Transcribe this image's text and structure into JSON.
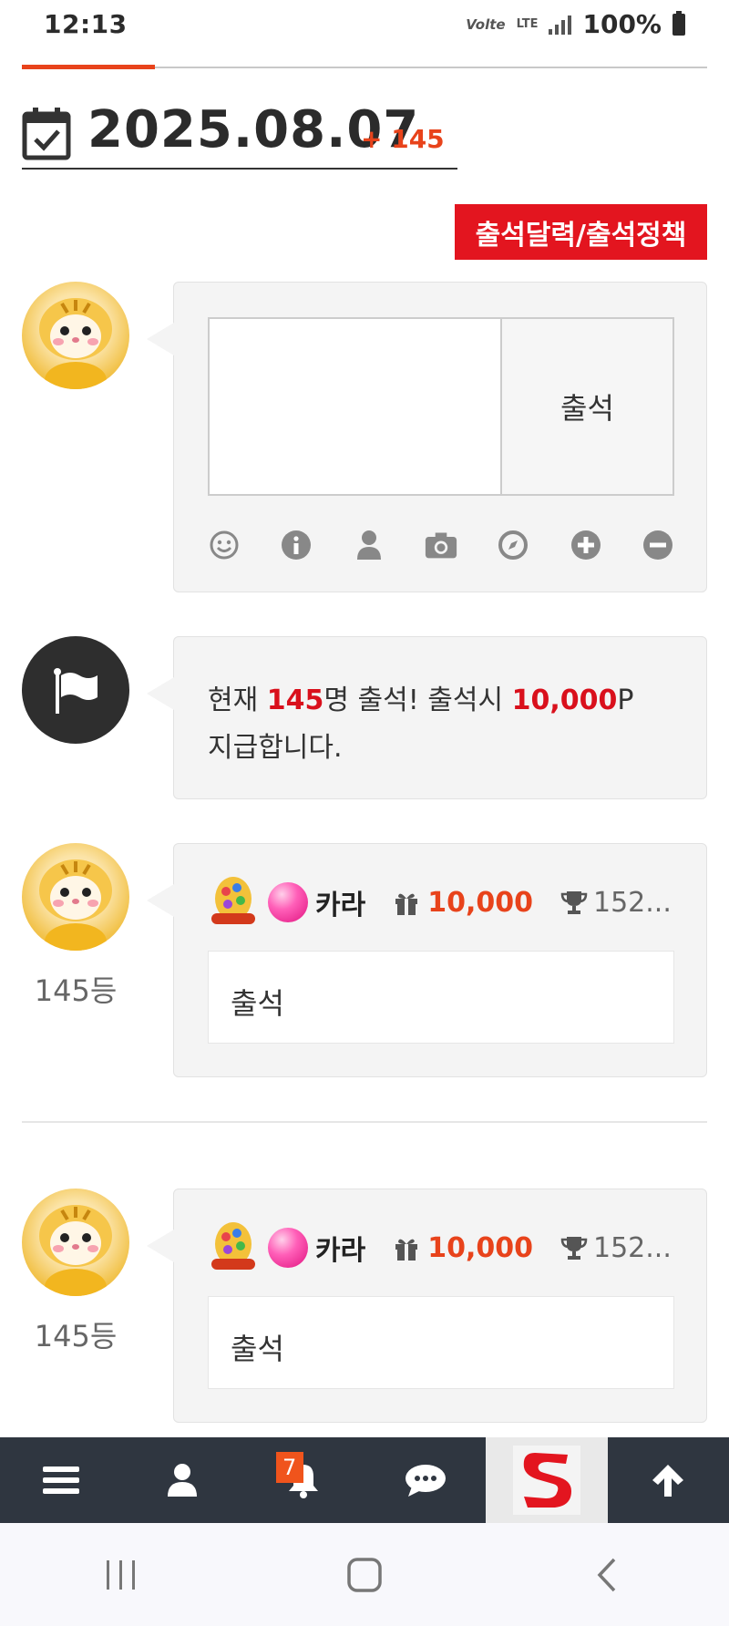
{
  "status_bar": {
    "time": "12:13",
    "volte": "Volte",
    "network": "LTE",
    "battery": "100%"
  },
  "header": {
    "date": "2025.08.07",
    "delta": "+ 145",
    "policy_button": "출석달력/출석정책"
  },
  "compose": {
    "textarea_value": "",
    "submit_label": "출석",
    "tools": [
      "smile-icon",
      "info-icon",
      "user-icon",
      "camera-icon",
      "compass-icon",
      "plus-circle-icon",
      "minus-circle-icon"
    ]
  },
  "notice": {
    "prefix": "현재 ",
    "count": "145",
    "mid": "명 출석! 출석시 ",
    "points": "10,000",
    "suffix": "P 지급합니다."
  },
  "entries": [
    {
      "rank": "145등",
      "nickname": "카라",
      "points": "10,000",
      "score": "152...",
      "message": "출석"
    },
    {
      "rank": "145등",
      "nickname": "카라",
      "points": "10,000",
      "score": "152...",
      "message": "출석"
    }
  ],
  "bottom_nav": {
    "items": [
      "menu-icon",
      "user-icon",
      "bell-icon",
      "chat-icon",
      "site-logo",
      "arrow-up-icon"
    ],
    "notification_count": "7"
  },
  "colors": {
    "accent": "#e8431b",
    "policy_red": "#e3151f",
    "nav_bg": "#2f3640",
    "notice_red": "#d9101c"
  }
}
